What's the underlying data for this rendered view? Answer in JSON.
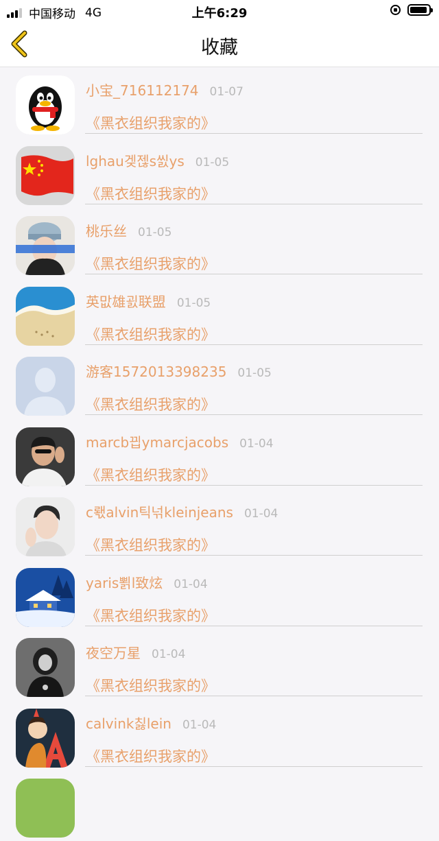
{
  "status_bar": {
    "carrier": "中国移动",
    "network": "4G",
    "time": "上午6:29"
  },
  "nav": {
    "title": "收藏"
  },
  "favorites": [
    {
      "user": "小宝_716112174",
      "date": "01-07",
      "title": "《黑衣组织我家的》",
      "avatar": "qq-penguin-avatar"
    },
    {
      "user": "lghau겢젢s씴ys",
      "date": "01-05",
      "title": "《黑衣组织我家的》",
      "avatar": "china-flag-avatar"
    },
    {
      "user": "桃乐丝",
      "date": "01-05",
      "title": "《黑衣组织我家的》",
      "avatar": "girl-cap-avatar"
    },
    {
      "user": "英맚雄굀联盟",
      "date": "01-05",
      "title": "《黑衣组织我家的》",
      "avatar": "beach-avatar"
    },
    {
      "user": "游客1572013398235",
      "date": "01-05",
      "title": "《黑衣组织我家的》",
      "avatar": "default-user-avatar"
    },
    {
      "user": "marcb끱ymarcjacobs",
      "date": "01-04",
      "title": "《黑衣组织我家的》",
      "avatar": "man-sunglasses-avatar"
    },
    {
      "user": "c뢗alvin틱넊kleinjeans",
      "date": "01-04",
      "title": "《黑衣组织我家的》",
      "avatar": "young-man-avatar"
    },
    {
      "user": "yaris뾝l致炫",
      "date": "01-04",
      "title": "《黑衣组织我家的》",
      "avatar": "snow-house-avatar"
    },
    {
      "user": "夜空万星",
      "date": "01-04",
      "title": "《黑衣组织我家的》",
      "avatar": "dark-figure-avatar"
    },
    {
      "user": "calvink칧lein",
      "date": "01-04",
      "title": "《黑衣组织我家的》",
      "avatar": "cartoon-letter-a-avatar"
    }
  ],
  "colors": {
    "accent": "#e8a06a",
    "date": "#b9b9b9",
    "back_arrow": "#e6b800"
  }
}
